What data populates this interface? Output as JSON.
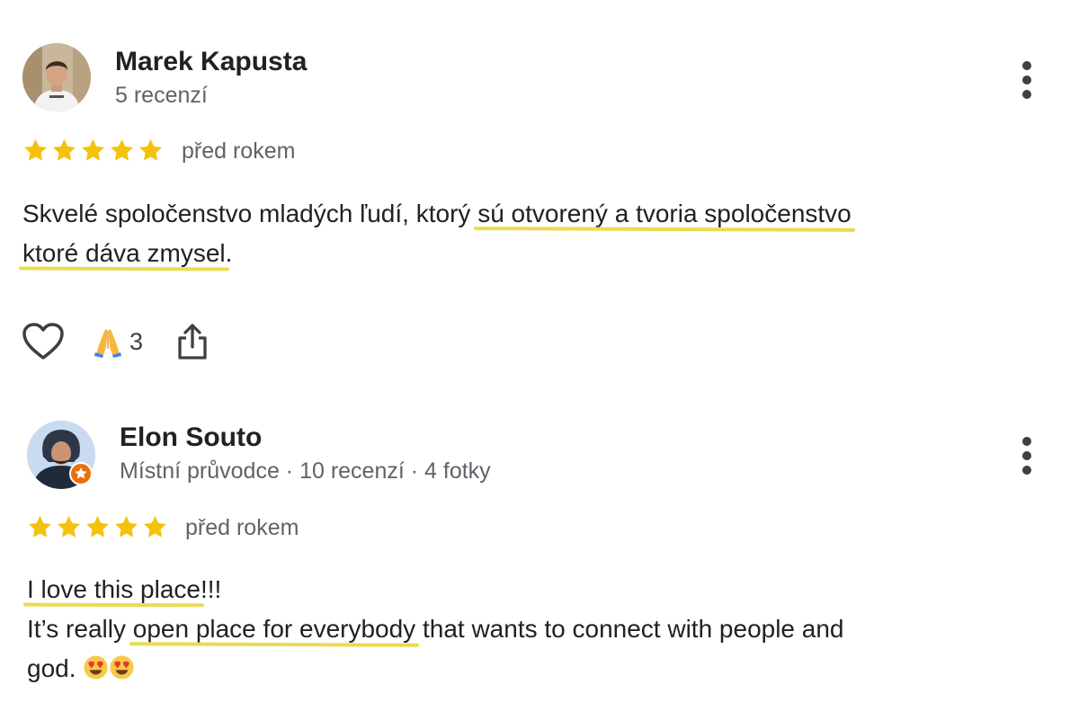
{
  "reviews": [
    {
      "author": "Marek Kapusta",
      "meta": "5 recenzí",
      "rating": 5,
      "time": "před rokem",
      "text": {
        "line1_a": "Skvelé spoločenstvo mladých ľudí, ktorý ",
        "line1_highlight": "sú otvorený a tvoria spoločenstvo",
        "line2_highlight": "ktoré dáva zmysel",
        "line2_b": "."
      },
      "reactions": {
        "emoji_icon": "folded-hands-emoji",
        "count": "3"
      },
      "icons": {
        "like": "heart-outline-icon",
        "share": "share-icon",
        "more": "more-vertical-icon"
      }
    },
    {
      "author": "Elon Souto",
      "meta": "Místní průvodce · 10 recenzí · 4 fotky",
      "rating": 5,
      "time": "před rokem",
      "text": {
        "line1_highlight": "I love this place",
        "line1_b": "!!!",
        "line2_a": "It’s really ",
        "line2_highlight": "open place for everybody",
        "line2_b": " that wants to connect with people and",
        "line3_a": "god. "
      },
      "icons": {
        "badge": "local-guide-badge-icon",
        "more": "more-vertical-icon",
        "emoji": "heart-eyes-emoji"
      }
    }
  ],
  "colors": {
    "star": "#f4c20d",
    "highlight_underline": "#e8dc52",
    "meta_text": "#5f6368",
    "guide_badge": "#e8710a"
  }
}
